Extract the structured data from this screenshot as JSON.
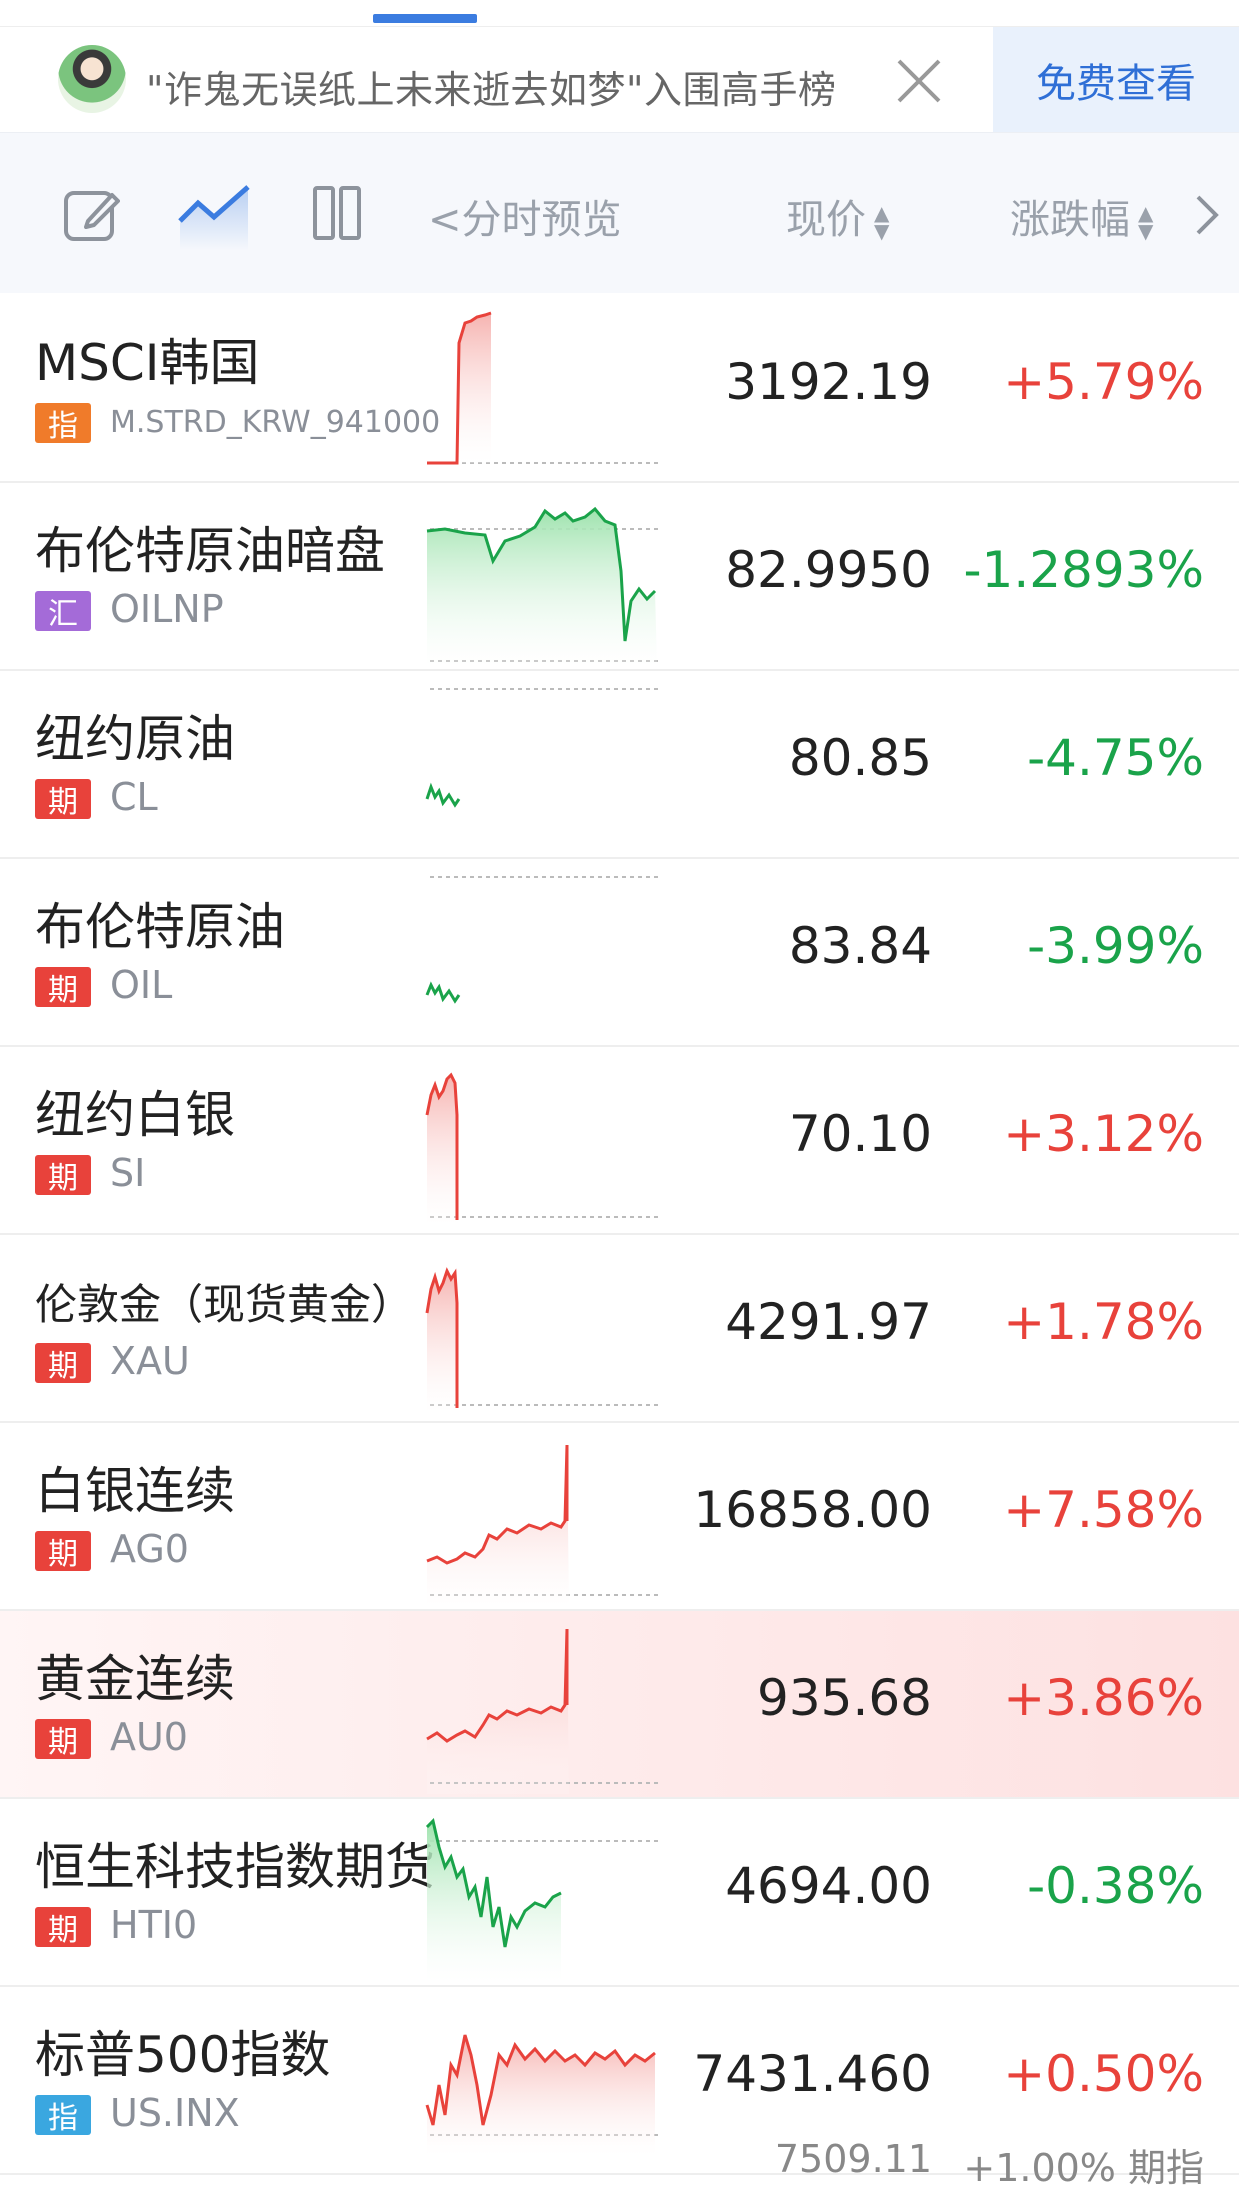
{
  "banner": {
    "text": "\"诈鬼无误纸上未来逝去如梦\"入围高手榜",
    "button": "免费查看"
  },
  "toolbar": {
    "preview_label": "分时预览",
    "price_label": "现价",
    "change_label": "涨跌幅"
  },
  "colors": {
    "up": "#e8423b",
    "down": "#1aa34a",
    "accent": "#2f6fd6"
  },
  "rows": [
    {
      "name": "MSCI韩国",
      "badge": "指",
      "badge_color": "#f07b2a",
      "code": "M.STRD_KRW_941000",
      "price": "3192.19",
      "change": "+5.79%",
      "dir": "up"
    },
    {
      "name": "布伦特原油暗盘",
      "badge": "汇",
      "badge_color": "#a46bd8",
      "code": "OILNP",
      "price": "82.9950",
      "change": "-1.2893%",
      "dir": "down"
    },
    {
      "name": "纽约原油",
      "badge": "期",
      "badge_color": "#e8423b",
      "code": "CL",
      "price": "80.85",
      "change": "-4.75%",
      "dir": "down"
    },
    {
      "name": "布伦特原油",
      "badge": "期",
      "badge_color": "#e8423b",
      "code": "OIL",
      "price": "83.84",
      "change": "-3.99%",
      "dir": "down"
    },
    {
      "name": "纽约白银",
      "badge": "期",
      "badge_color": "#e8423b",
      "code": "SI",
      "price": "70.10",
      "change": "+3.12%",
      "dir": "up"
    },
    {
      "name": "伦敦金（现货黄金）",
      "badge": "期",
      "badge_color": "#e8423b",
      "code": "XAU",
      "price": "4291.97",
      "change": "+1.78%",
      "dir": "up"
    },
    {
      "name": "白银连续",
      "badge": "期",
      "badge_color": "#e8423b",
      "code": "AG0",
      "price": "16858.00",
      "change": "+7.58%",
      "dir": "up"
    },
    {
      "name": "黄金连续",
      "badge": "期",
      "badge_color": "#e8423b",
      "code": "AU0",
      "price": "935.68",
      "change": "+3.86%",
      "dir": "up"
    },
    {
      "name": "恒生科技指数期货",
      "badge": "期",
      "badge_color": "#e8423b",
      "code": "HTI0",
      "price": "4694.00",
      "change": "-0.38%",
      "dir": "down"
    },
    {
      "name": "标普500指数",
      "badge": "指",
      "badge_color": "#3aa7e0",
      "code": "US.INX",
      "price": "7431.460",
      "change": "+0.50%",
      "dir": "up",
      "sub_price": "7509.11",
      "sub_change": "+1.00% 期指"
    }
  ]
}
